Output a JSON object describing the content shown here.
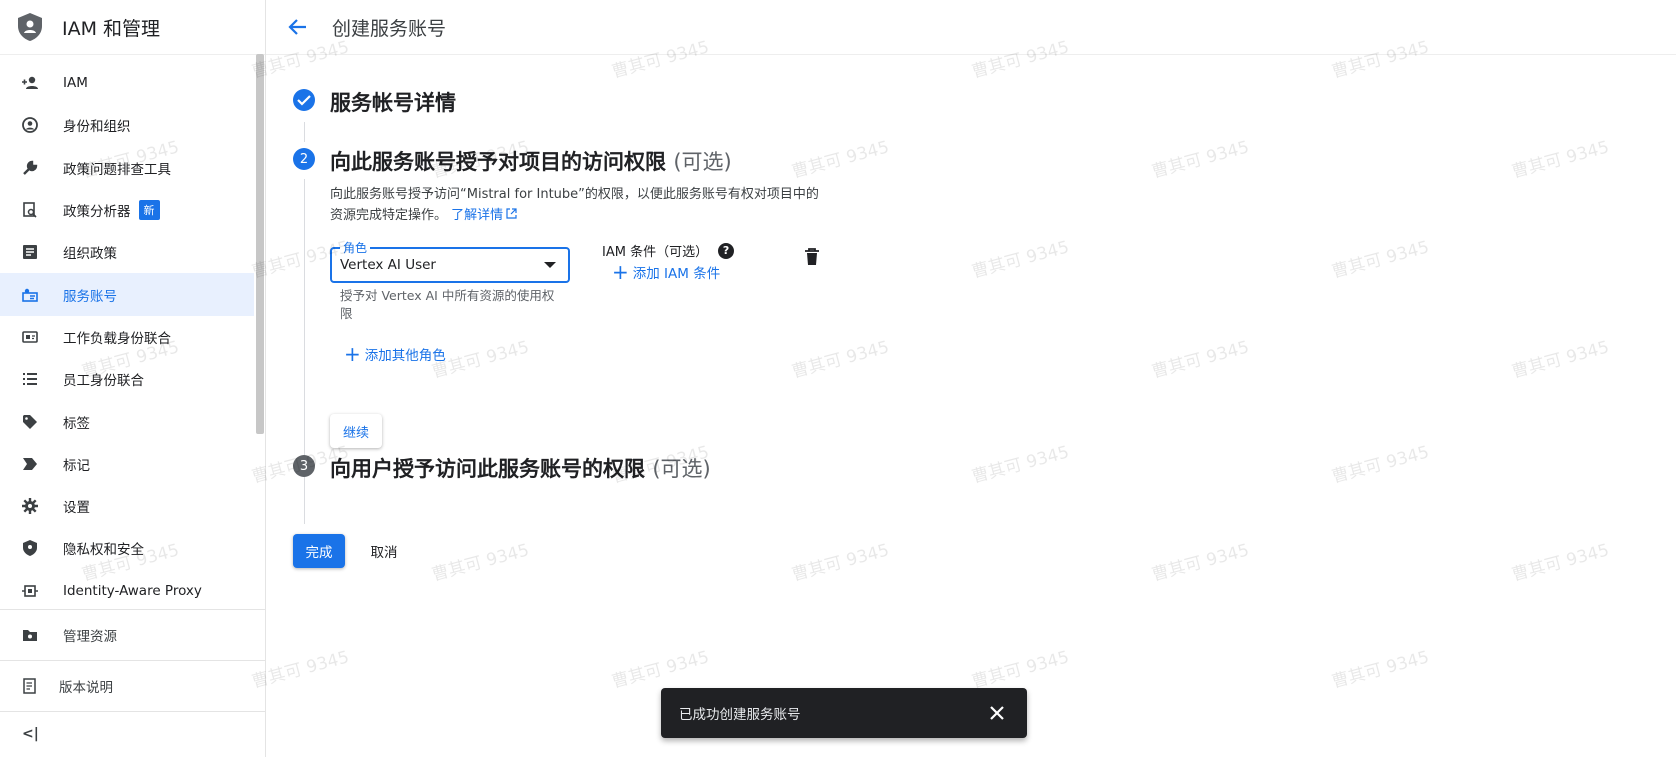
{
  "app_title": "IAM 和管理",
  "page_title": "创建服务账号",
  "sidebar": {
    "items": [
      {
        "label": "IAM",
        "icon": "person-add-icon"
      },
      {
        "label": "身份和组织",
        "icon": "account-circle-icon"
      },
      {
        "label": "政策问题排查工具",
        "icon": "wrench-icon"
      },
      {
        "label": "政策分析器",
        "icon": "policy-search-icon",
        "badge": "新"
      },
      {
        "label": "组织政策",
        "icon": "document-icon"
      },
      {
        "label": "服务账号",
        "icon": "service-account-icon"
      },
      {
        "label": "工作负载身份联合",
        "icon": "id-card-icon"
      },
      {
        "label": "员工身份联合",
        "icon": "list-icon"
      },
      {
        "label": "标签",
        "icon": "tag-icon"
      },
      {
        "label": "标记",
        "icon": "label-icon"
      },
      {
        "label": "设置",
        "icon": "gear-icon"
      },
      {
        "label": "隐私权和安全",
        "icon": "shield-icon"
      },
      {
        "label": "Identity-Aware Proxy",
        "icon": "proxy-icon"
      }
    ],
    "active_index": 5,
    "manage_resources": "管理资源",
    "release_notes": "版本说明",
    "collapse_label": "<|"
  },
  "steps": {
    "step1_title": "服务帐号详情",
    "step2_number": "2",
    "step2_title": "向此服务账号授予对项目的访问权限",
    "step2_optional": "(可选)",
    "step2_desc_1": "向此服务账号授予访问“Mistral for Intube”的权限，以便此服务账号有权对项目中的",
    "step2_desc_2": "资源完成特定操作。",
    "learn_more": "了解详情",
    "step3_number": "3",
    "step3_title": "向用户授予访问此服务账号的权限",
    "step3_optional": "(可选)"
  },
  "role": {
    "label": "角色",
    "value": "Vertex AI User",
    "hint": "授予对 Vertex AI 中所有资源的使用权限"
  },
  "iam_condition": {
    "label": "IAM 条件（可选）",
    "add_label": "添加 IAM 条件"
  },
  "add_role_label": "添加其他角色",
  "buttons": {
    "continue": "继续",
    "done": "完成",
    "cancel": "取消"
  },
  "snackbar": {
    "message": "已成功创建服务账号"
  },
  "watermark": "曹其可 9345",
  "colors": {
    "accent": "#1a73e8",
    "active_bg": "#e8f0fe",
    "snackbar_bg": "#202124"
  }
}
